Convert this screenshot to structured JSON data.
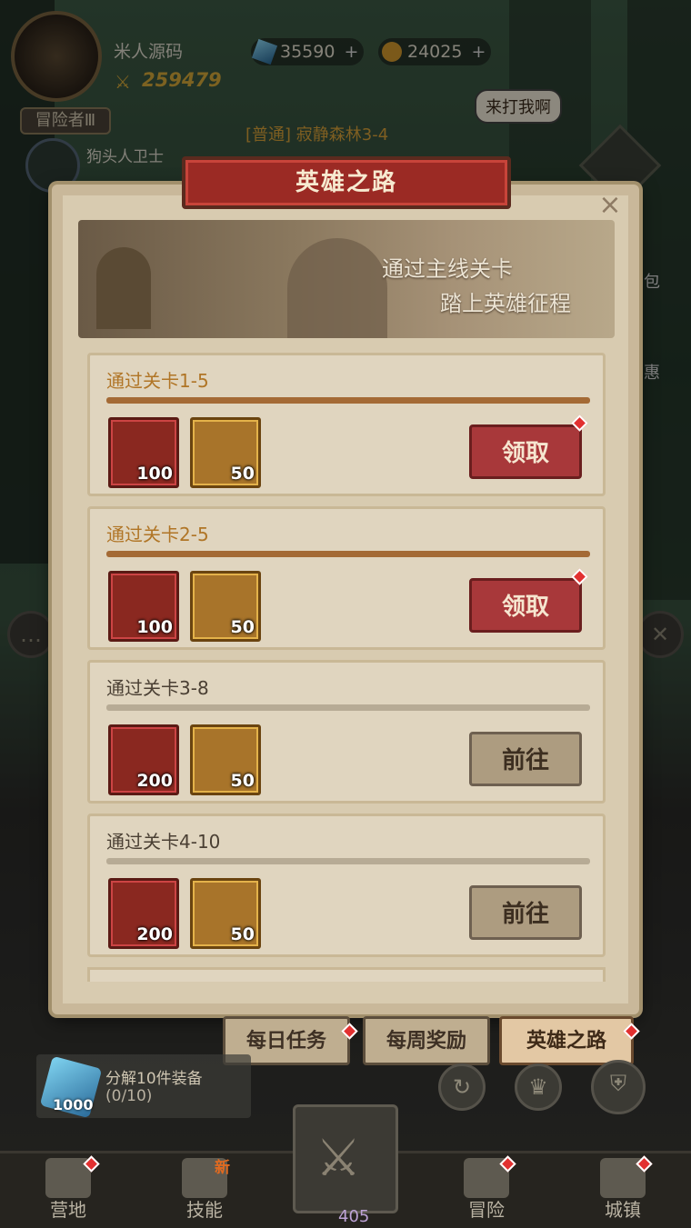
{
  "player": {
    "name": "米人源码",
    "power": "259479",
    "rank": "冒险者Ⅲ"
  },
  "currency": {
    "gems": "35590",
    "coins": "24025"
  },
  "enemy": {
    "name": "狗头人卫士"
  },
  "stage": {
    "label": "[普通] 寂静森林3-4"
  },
  "speech_bubble": "来打我啊",
  "dialog": {
    "title": "英雄之路",
    "banner_line1": "通过主线关卡",
    "banner_line2": "踏上英雄征程",
    "close_icon": "×"
  },
  "tasks": [
    {
      "title": "通过关卡1-5",
      "gold": "100",
      "soul": "50",
      "button": "领取",
      "state": "claim"
    },
    {
      "title": "通过关卡2-5",
      "gold": "100",
      "soul": "50",
      "button": "领取",
      "state": "claim"
    },
    {
      "title": "通过关卡3-8",
      "gold": "200",
      "soul": "50",
      "button": "前往",
      "state": "go"
    },
    {
      "title": "通过关卡4-10",
      "gold": "200",
      "soul": "50",
      "button": "前往",
      "state": "go"
    }
  ],
  "tabs": [
    {
      "label": "每日任务"
    },
    {
      "label": "每周奖励"
    },
    {
      "label": "英雄之路"
    }
  ],
  "quest": {
    "title": "分解10件装备",
    "progress": "(0/10)",
    "reward": "1000"
  },
  "bottom_nav": {
    "camp": "营地",
    "skills": "技能",
    "skills_badge": "新",
    "center_count": "405",
    "adventure": "冒险",
    "town": "城镇"
  },
  "side_labels": {
    "bag": "包",
    "sale": "惠"
  },
  "colors": {
    "claim_button": "#a8383a",
    "progress_complete": "#a46a35",
    "title_banner": "#9b2a24"
  }
}
